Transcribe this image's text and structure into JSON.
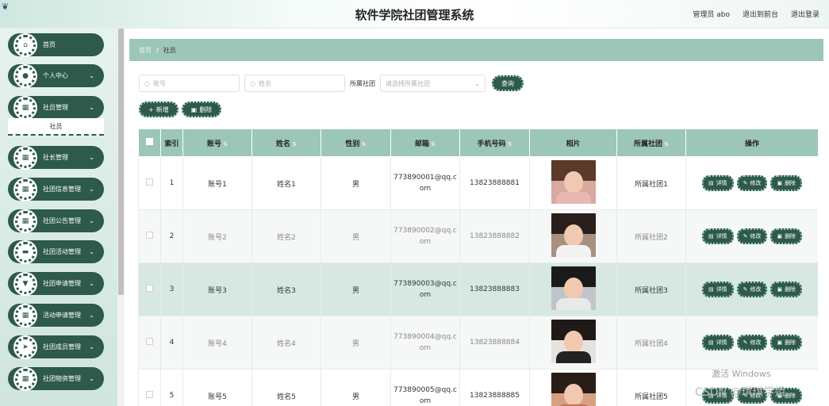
{
  "header": {
    "title": "软件学院社团管理系统",
    "admin_label": "管理员 abo",
    "goto_front": "退出到前台",
    "logout": "退出登录"
  },
  "sidebar": {
    "items": [
      {
        "label": "首页",
        "icon": "home-icon",
        "glyph": "⌂",
        "chevron": false
      },
      {
        "label": "个人中心",
        "icon": "user-icon",
        "glyph": "●",
        "chevron": true
      },
      {
        "label": "社员管理",
        "icon": "grid-icon",
        "glyph": "▦",
        "chevron": true
      },
      {
        "label": "社长管理",
        "icon": "grid-icon",
        "glyph": "▦",
        "chevron": true
      },
      {
        "label": "社团信息管理",
        "icon": "grid-icon",
        "glyph": "▦",
        "chevron": true
      },
      {
        "label": "社团公告管理",
        "icon": "grid-icon",
        "glyph": "▦",
        "chevron": true
      },
      {
        "label": "社团活动管理",
        "icon": "briefcase-icon",
        "glyph": "▬",
        "chevron": true
      },
      {
        "label": "社团申请管理",
        "icon": "shield-icon",
        "glyph": "▼",
        "chevron": true
      },
      {
        "label": "活动申请管理",
        "icon": "grid-icon",
        "glyph": "▦",
        "chevron": true
      },
      {
        "label": "社团成员管理",
        "icon": "send-icon",
        "glyph": "➤",
        "chevron": true
      },
      {
        "label": "社团物资管理",
        "icon": "grid-icon",
        "glyph": "▦",
        "chevron": true
      }
    ],
    "sub_item": "社员"
  },
  "breadcrumb": {
    "home": "首页",
    "sep": "/",
    "current": "社员"
  },
  "search": {
    "account_placeholder": "账号",
    "name_placeholder": "姓名",
    "club_label": "所属社团",
    "club_placeholder": "请选择所属社团",
    "query_button": "查询"
  },
  "toolbar": {
    "add_label": "新增",
    "delete_label": "删除"
  },
  "table": {
    "columns": [
      "索引",
      "账号",
      "姓名",
      "性别",
      "邮箱",
      "手机号码",
      "相片",
      "所属社团",
      "操作"
    ],
    "rows": [
      {
        "index": "1",
        "account": "账号1",
        "name": "姓名1",
        "gender": "男",
        "email": "773890001@qq.com",
        "phone": "13823888881",
        "club": "所属社团1"
      },
      {
        "index": "2",
        "account": "账号2",
        "name": "姓名2",
        "gender": "男",
        "email": "773890002@qq.com",
        "phone": "13823888882",
        "club": "所属社团2"
      },
      {
        "index": "3",
        "account": "账号3",
        "name": "姓名3",
        "gender": "男",
        "email": "773890003@qq.com",
        "phone": "13823888883",
        "club": "所属社团3"
      },
      {
        "index": "4",
        "account": "账号4",
        "name": "姓名4",
        "gender": "男",
        "email": "773890004@qq.com",
        "phone": "13823888884",
        "club": "所属社团4"
      },
      {
        "index": "5",
        "account": "账号5",
        "name": "姓名5",
        "gender": "男",
        "email": "773890005@qq.com",
        "phone": "13823888885",
        "club": "所属社团5"
      }
    ],
    "op_detail": "详情",
    "op_edit": "修改",
    "op_delete": "删除"
  },
  "watermark": {
    "line1": "激活 Windows",
    "line2": "CSDN @琪琪学姐"
  },
  "colors": {
    "accent": "#2d5a4a",
    "header_bg": "#9cc6b9"
  }
}
